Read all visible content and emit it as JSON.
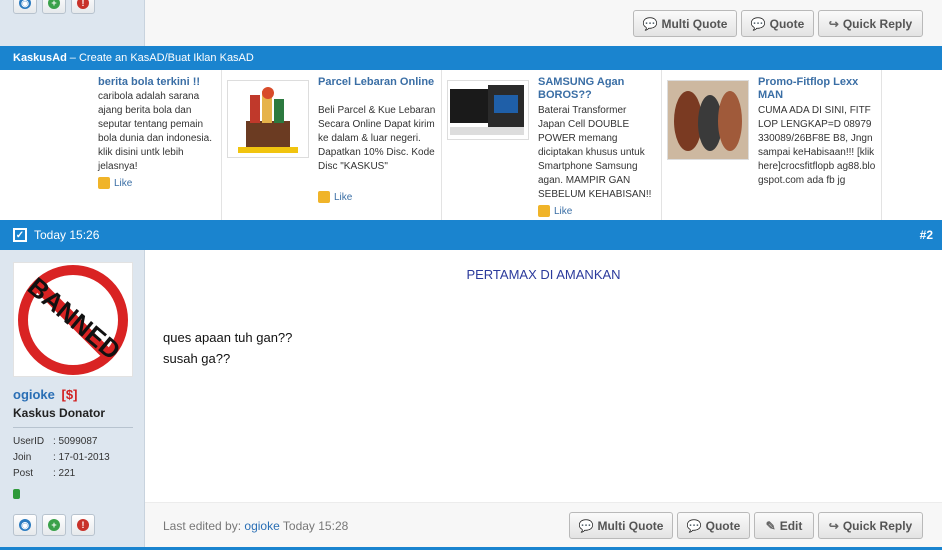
{
  "top_buttons": {
    "multi_quote": "Multi Quote",
    "quote": "Quote",
    "quick_reply": "Quick Reply"
  },
  "ad_bar": {
    "brand": "KaskusAd",
    "text": "– Create an KasAD/Buat Iklan KasAD"
  },
  "ads": [
    {
      "title": "berita bola terkini !!",
      "body": "caribola adalah sarana ajang berita bola dan seputar tentang pemain bola dunia dan indonesia. klik disini untk lebih jelasnya!",
      "like": "Like"
    },
    {
      "title": "Parcel Lebaran Online",
      "body": "Beli Parcel & Kue Lebaran Secara Online Dapat kirim ke dalam & luar negeri. Dapatkan 10% Disc. Kode Disc \"KASKUS\"",
      "like": "Like"
    },
    {
      "title": "SAMSUNG Agan BOROS??",
      "body": "Baterai Transformer Japan Cell DOUBLE POWER memang diciptakan khusus untuk Smartphone Samsung agan. MAMPIR GAN SEBELUM KEHABISAN!!",
      "like": "Like"
    },
    {
      "title": "Promo-Fitflop Lexx MAN",
      "body": "CUMA ADA DI SINI, FITFLOP LENGKAP=D 08979330089/26BF8E B8, Jngn sampai keHabisaan!!! [klik here]crocsfitflopb ag88.blogspot.com ada fb jg",
      "like": "Like"
    }
  ],
  "post_header": {
    "time": "Today 15:26",
    "number": "#2"
  },
  "user": {
    "avatar_text": "BANNED",
    "name": "ogioke",
    "badge": "[$]",
    "rank": "Kaskus Donator",
    "userid_label": "UserID",
    "userid_value": ": 5099087",
    "join_label": "Join",
    "join_value": ": 17-01-2013",
    "post_label": "Post",
    "post_value": ": 221"
  },
  "post": {
    "title": "PERTAMAX DI AMANKAN",
    "line1": "ques apaan tuh gan??",
    "line2": "susah ga??",
    "edited_prefix": "Last edited by:",
    "edited_user": "ogioke",
    "edited_time": "Today 15:28"
  },
  "bottom_buttons": {
    "multi_quote": "Multi Quote",
    "quote": "Quote",
    "edit": "Edit",
    "quick_reply": "Quick Reply"
  },
  "colors": {
    "bar_blue": "#1a84cf",
    "link_blue": "#3a6ea5",
    "post_title": "#2b3a9c",
    "sidebar": "#dde6ef"
  }
}
